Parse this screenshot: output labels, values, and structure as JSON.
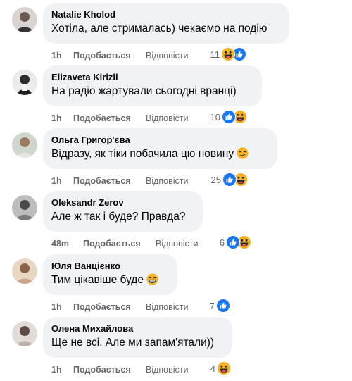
{
  "actions": {
    "like": "Подобається",
    "reply": "Відповісти"
  },
  "comments": [
    {
      "author": "Natalie Kholod",
      "text": "Хотіла, але стрималась) чекаємо на подію",
      "time": "1h",
      "count": "11",
      "reactions": [
        "haha-icon",
        "like-icon"
      ]
    },
    {
      "author": "Elizaveta Kirizii",
      "text": "На радіо жартували сьогодні вранці)",
      "time": "1h",
      "count": "10",
      "reactions": [
        "like-icon",
        "haha-icon"
      ]
    },
    {
      "author": "Ольга Григор'єва",
      "text": "Відразу, як тіки побачила цю новину",
      "time": "1h",
      "count": "25",
      "reactions": [
        "like-icon",
        "haha-icon"
      ],
      "inline_emoji": "smirk-emoji"
    },
    {
      "author": "Oleksandr Zerov",
      "text": "Але ж так і буде? Правда?",
      "time": "48m",
      "count": "6",
      "reactions": [
        "like-icon",
        "haha-icon"
      ]
    },
    {
      "author": "Юля Ванцієнко",
      "text": "Тим цікавіше буде",
      "time": "1h",
      "count": "7",
      "reactions": [
        "like-icon"
      ],
      "inline_emoji": "grin-emoji"
    },
    {
      "author": "Олена Михайлова",
      "text": "Ще не всі. Але ми запам'ятали))",
      "time": "1h",
      "count": "4",
      "reactions": [
        "haha-icon"
      ]
    }
  ],
  "colors": {
    "bubble": "#f0f2f5",
    "like": "#1877f2",
    "haha": "#f7b125",
    "meta": "#65676b"
  }
}
